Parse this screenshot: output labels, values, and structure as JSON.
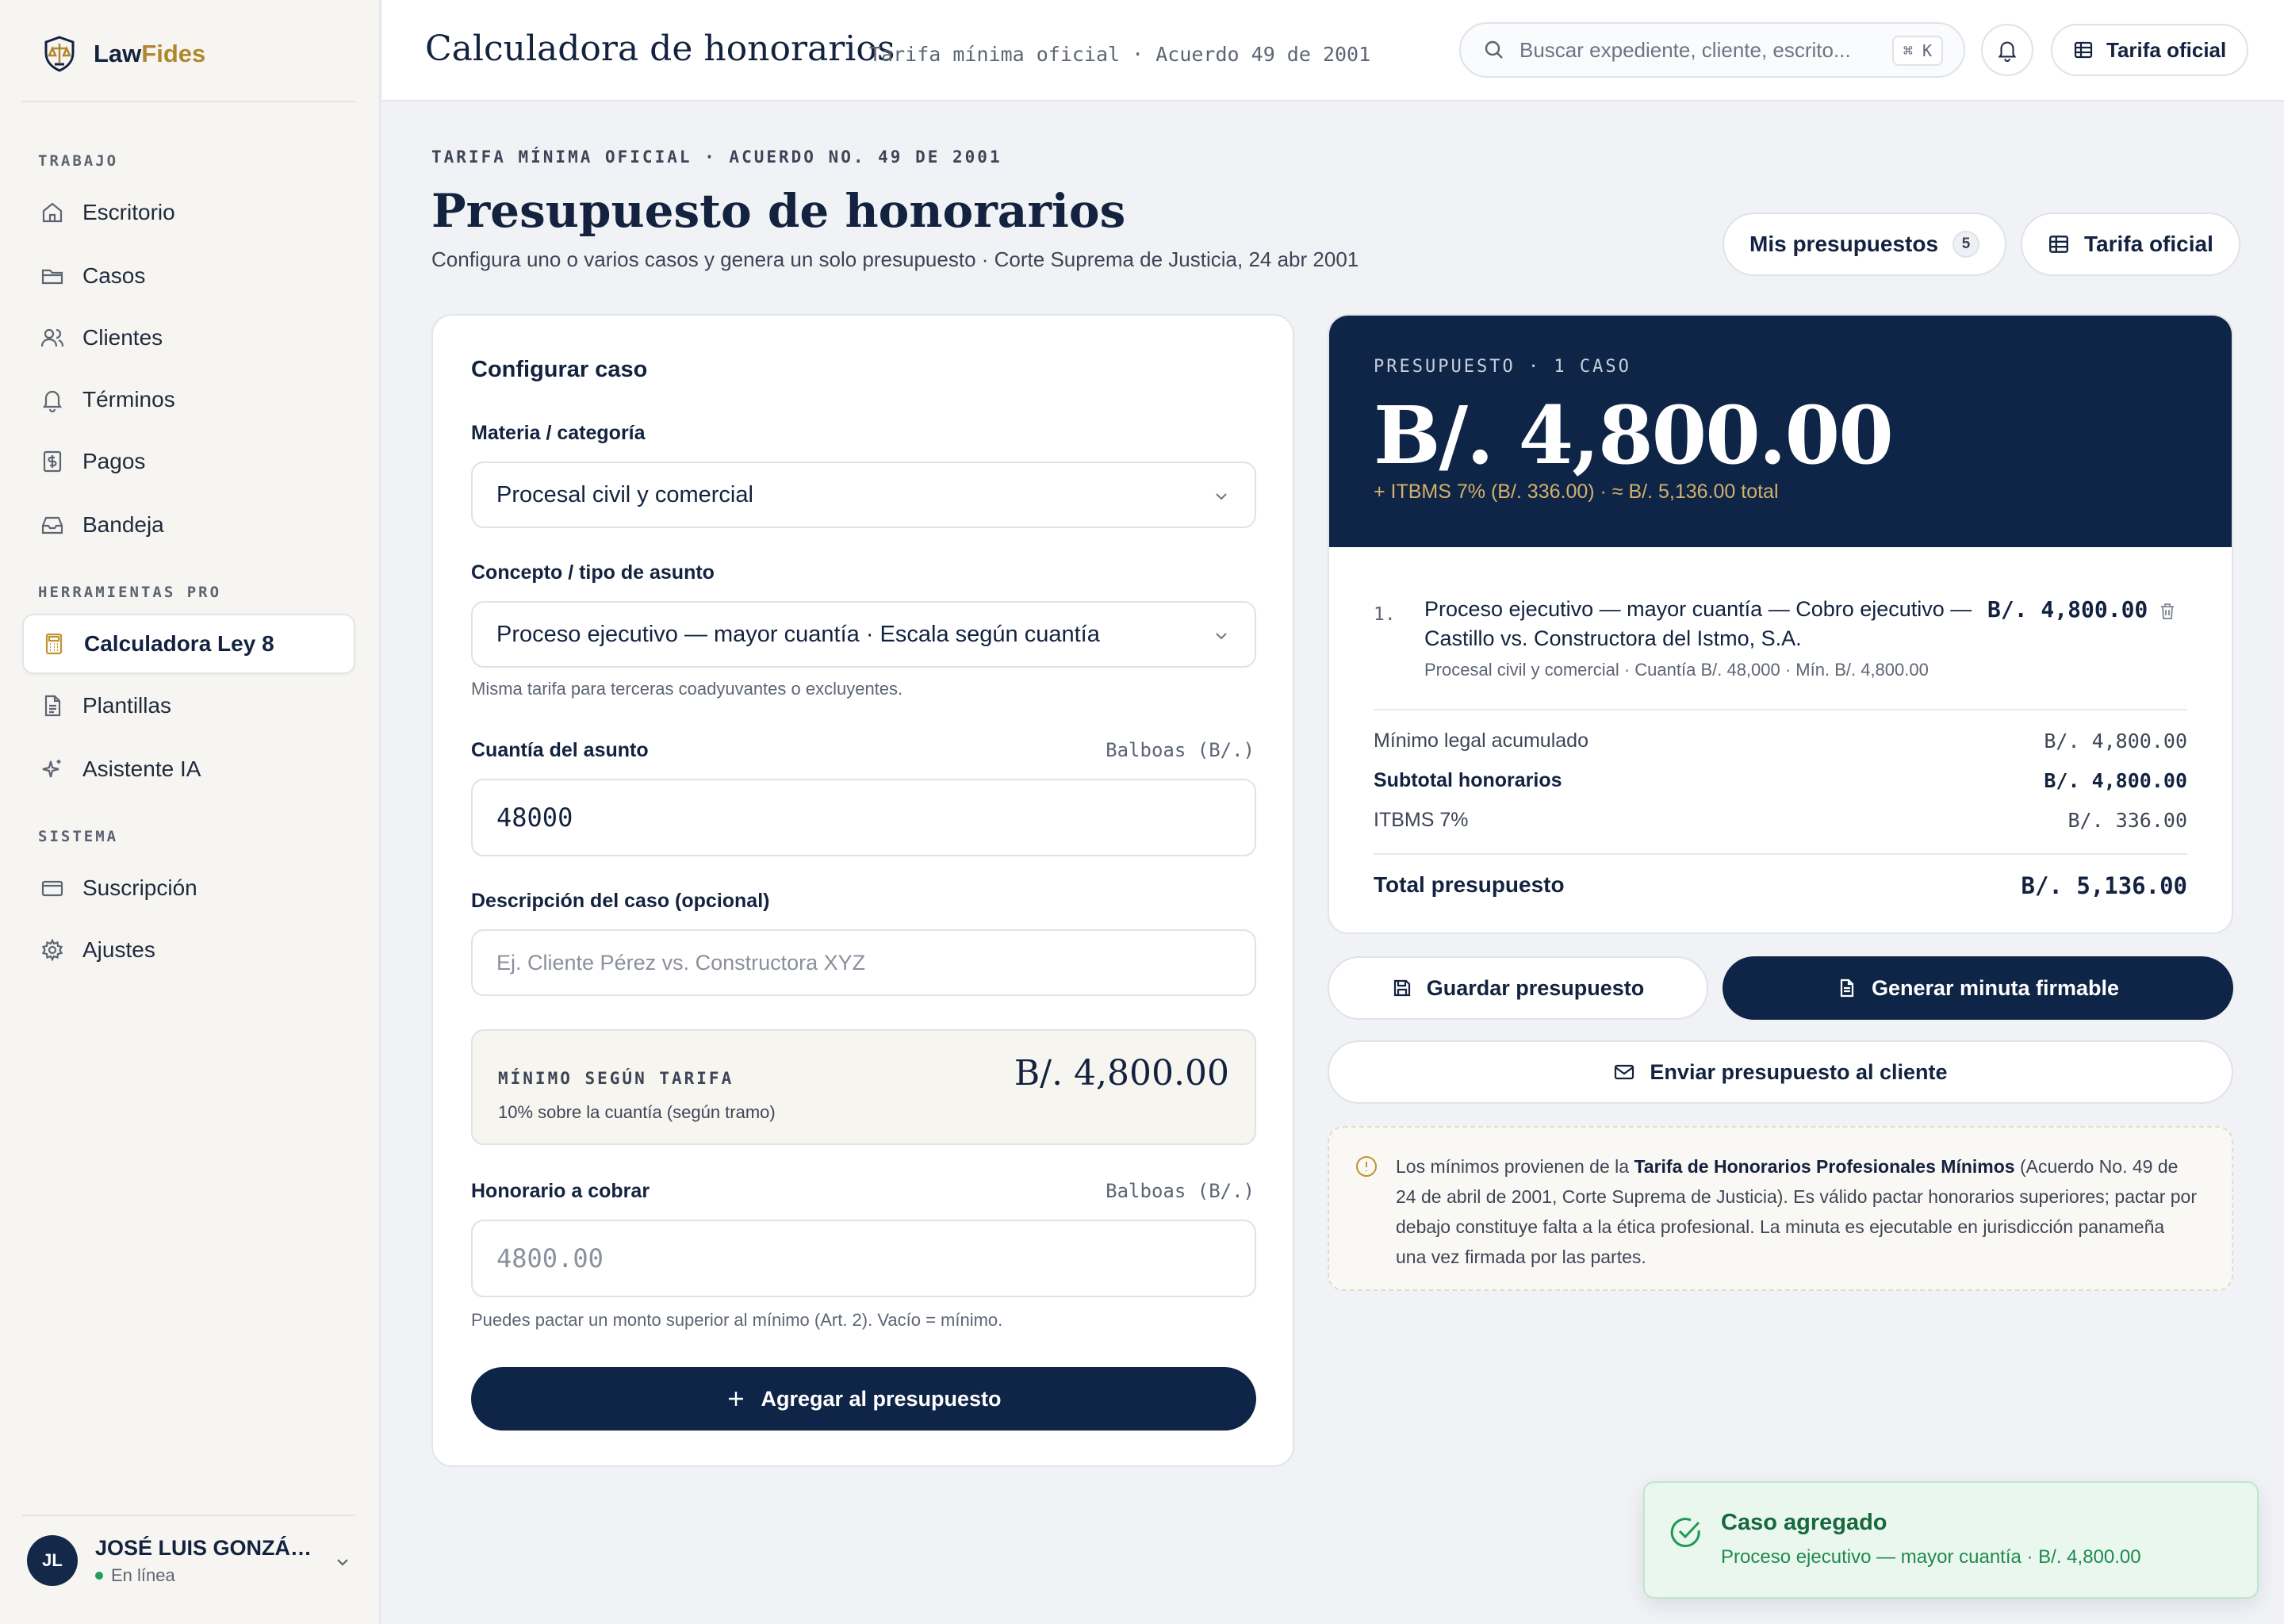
{
  "brand": {
    "name_a": "Law",
    "name_b": "Fides",
    "accent_color": "#b0872f"
  },
  "sidebar": {
    "sections": [
      {
        "label": "TRABAJO"
      },
      {
        "label": "HERRAMIENTAS PRO"
      },
      {
        "label": "SISTEMA"
      }
    ],
    "items": [
      {
        "label": "Escritorio",
        "icon": "home-icon"
      },
      {
        "label": "Casos",
        "icon": "folder-icon"
      },
      {
        "label": "Clientes",
        "icon": "users-icon"
      },
      {
        "label": "Términos",
        "icon": "bell-icon"
      },
      {
        "label": "Pagos",
        "icon": "dollar-doc-icon"
      },
      {
        "label": "Bandeja",
        "icon": "inbox-icon"
      },
      {
        "label": "Calculadora Ley 8",
        "icon": "calculator-icon",
        "active": true
      },
      {
        "label": "Plantillas",
        "icon": "document-icon"
      },
      {
        "label": "Asistente IA",
        "icon": "sparkle-icon"
      },
      {
        "label": "Suscripción",
        "icon": "credit-card-icon"
      },
      {
        "label": "Ajustes",
        "icon": "gear-icon"
      }
    ],
    "user": {
      "initials": "JL",
      "name": "JOSÉ LUIS GONZÁLEZ",
      "status": "En línea"
    }
  },
  "topbar": {
    "title": "Calculadora de honorarios",
    "subtitle": "Tarifa mínima oficial · Acuerdo 49 de 2001",
    "search_placeholder": "Buscar expediente, cliente, escrito...",
    "search_shortcut": "⌘ K",
    "tarifa_label": "Tarifa oficial"
  },
  "header": {
    "eyebrow": "TARIFA MÍNIMA OFICIAL · ACUERDO NO. 49 DE 2001",
    "title": "Presupuesto de honorarios",
    "subtitle": "Configura uno o varios casos y genera un solo presupuesto · Corte Suprema de Justicia, 24 abr 2001",
    "mis_presupuestos_label": "Mis presupuestos",
    "mis_presupuestos_count": "5",
    "tarifa_label": "Tarifa oficial"
  },
  "form": {
    "title": "Configurar caso",
    "materia_label": "Materia / categoría",
    "materia_value": "Procesal civil y comercial",
    "concepto_label": "Concepto / tipo de asunto",
    "concepto_value": "Proceso ejecutivo — mayor cuantía · Escala según cuantía",
    "concepto_hint": "Misma tarifa para terceras coadyuvantes o excluyentes.",
    "cuantia_label": "Cuantía del asunto",
    "cuantia_unit": "Balboas (B/.)",
    "cuantia_value": "48000",
    "descripcion_label": "Descripción del caso (opcional)",
    "descripcion_placeholder": "Ej. Cliente Pérez vs. Constructora XYZ",
    "minimo_label": "MÍNIMO SEGÚN TARIFA",
    "minimo_desc": "10% sobre la cuantía (según tramo)",
    "minimo_value": "B/. 4,800.00",
    "honorario_label": "Honorario a cobrar",
    "honorario_unit": "Balboas (B/.)",
    "honorario_placeholder": "4800.00",
    "honorario_hint": "Puedes pactar un monto superior al mínimo (Art. 2). Vacío = mínimo.",
    "add_button": "Agregar al presupuesto"
  },
  "budget": {
    "eyebrow": "PRESUPUESTO · 1 CASO",
    "total": "B/. 4,800.00",
    "tax_note": "+ ITBMS 7% (B/. 336.00) · ≈ B/. 5,136.00 total",
    "items": [
      {
        "num": "1.",
        "title": "Proceso ejecutivo — mayor cuantía — Cobro ejecutivo — Castillo vs. Constructora del Istmo, S.A.",
        "meta": "Procesal civil y comercial · Cuantía B/. 48,000 · Mín. B/. 4,800.00",
        "amount": "B/. 4,800.00"
      }
    ],
    "rows": {
      "minimo_label": "Mínimo legal acumulado",
      "minimo_value": "B/. 4,800.00",
      "subtotal_label": "Subtotal honorarios",
      "subtotal_value": "B/. 4,800.00",
      "itbms_label": "ITBMS 7%",
      "itbms_value": "B/. 336.00",
      "total_label": "Total presupuesto",
      "total_value": "B/. 5,136.00"
    }
  },
  "actions": {
    "save": "Guardar presupuesto",
    "generate": "Generar minuta firmable",
    "send": "Enviar presupuesto al cliente"
  },
  "info": {
    "pre": "Los mínimos provienen de la ",
    "bold": "Tarifa de Honorarios Profesionales Mínimos",
    "post": " (Acuerdo No. 49 de 24 de abril de 2001, Corte Suprema de Justicia). Es válido pactar honorarios superiores; pactar por debajo constituye falta a la ética profesional. La minuta es ejecutable en jurisdicción panameña una vez firmada por las partes."
  },
  "toast": {
    "title": "Caso agregado",
    "message": "Proceso ejecutivo — mayor cuantía · B/. 4,800.00"
  }
}
